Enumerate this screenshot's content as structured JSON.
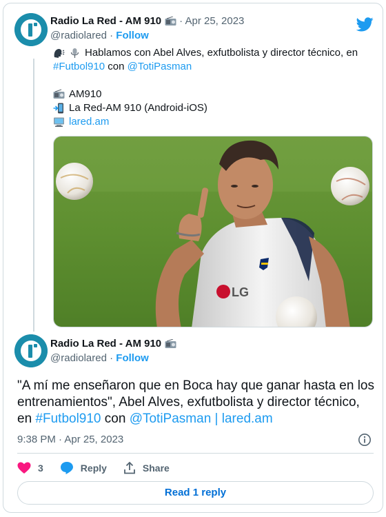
{
  "reply_tweet": {
    "author_name": "Radio La Red - AM 910",
    "handle": "@radiolared",
    "dot": "·",
    "follow": "Follow",
    "date": "· Apr 25, 2023",
    "line1_text": "Hablamos con Abel Alves, exfutbolista y director técnico, en",
    "hashtag": "#Futbol910",
    "con": " con ",
    "mention": "@TotiPasman",
    "station": "AM910",
    "app": "La Red-AM 910 (Android-iOS)",
    "link": "lared.am",
    "icons": [
      "speaking-head-icon",
      "microphone-icon",
      "radio-icon",
      "mobile-arrow-icon",
      "computer-icon"
    ]
  },
  "main_tweet": {
    "author_name": "Radio La Red - AM 910",
    "handle": "@radiolared",
    "dot": "·",
    "follow": "Follow",
    "text_quote": "\"A mí me enseñaron que en Boca hay que ganar hasta en los entrenamientos\", Abel Alves, exfutbolista y director técnico, en ",
    "hashtag": "#Futbol910",
    "con": " con ",
    "mention": "@TotiPasman",
    "sep": " | ",
    "link": "lared.am",
    "timestamp": "9:38 PM · Apr 25, 2023"
  },
  "actions": {
    "likes": "3",
    "reply_label": "Reply",
    "share_label": "Share"
  },
  "read_reply": "Read 1 reply",
  "colors": {
    "link_blue": "#1d9bf0",
    "avatar_teal": "#1b8dab",
    "heart_pink": "#f91880",
    "border": "#cfd9de",
    "text_grey": "#536471"
  }
}
